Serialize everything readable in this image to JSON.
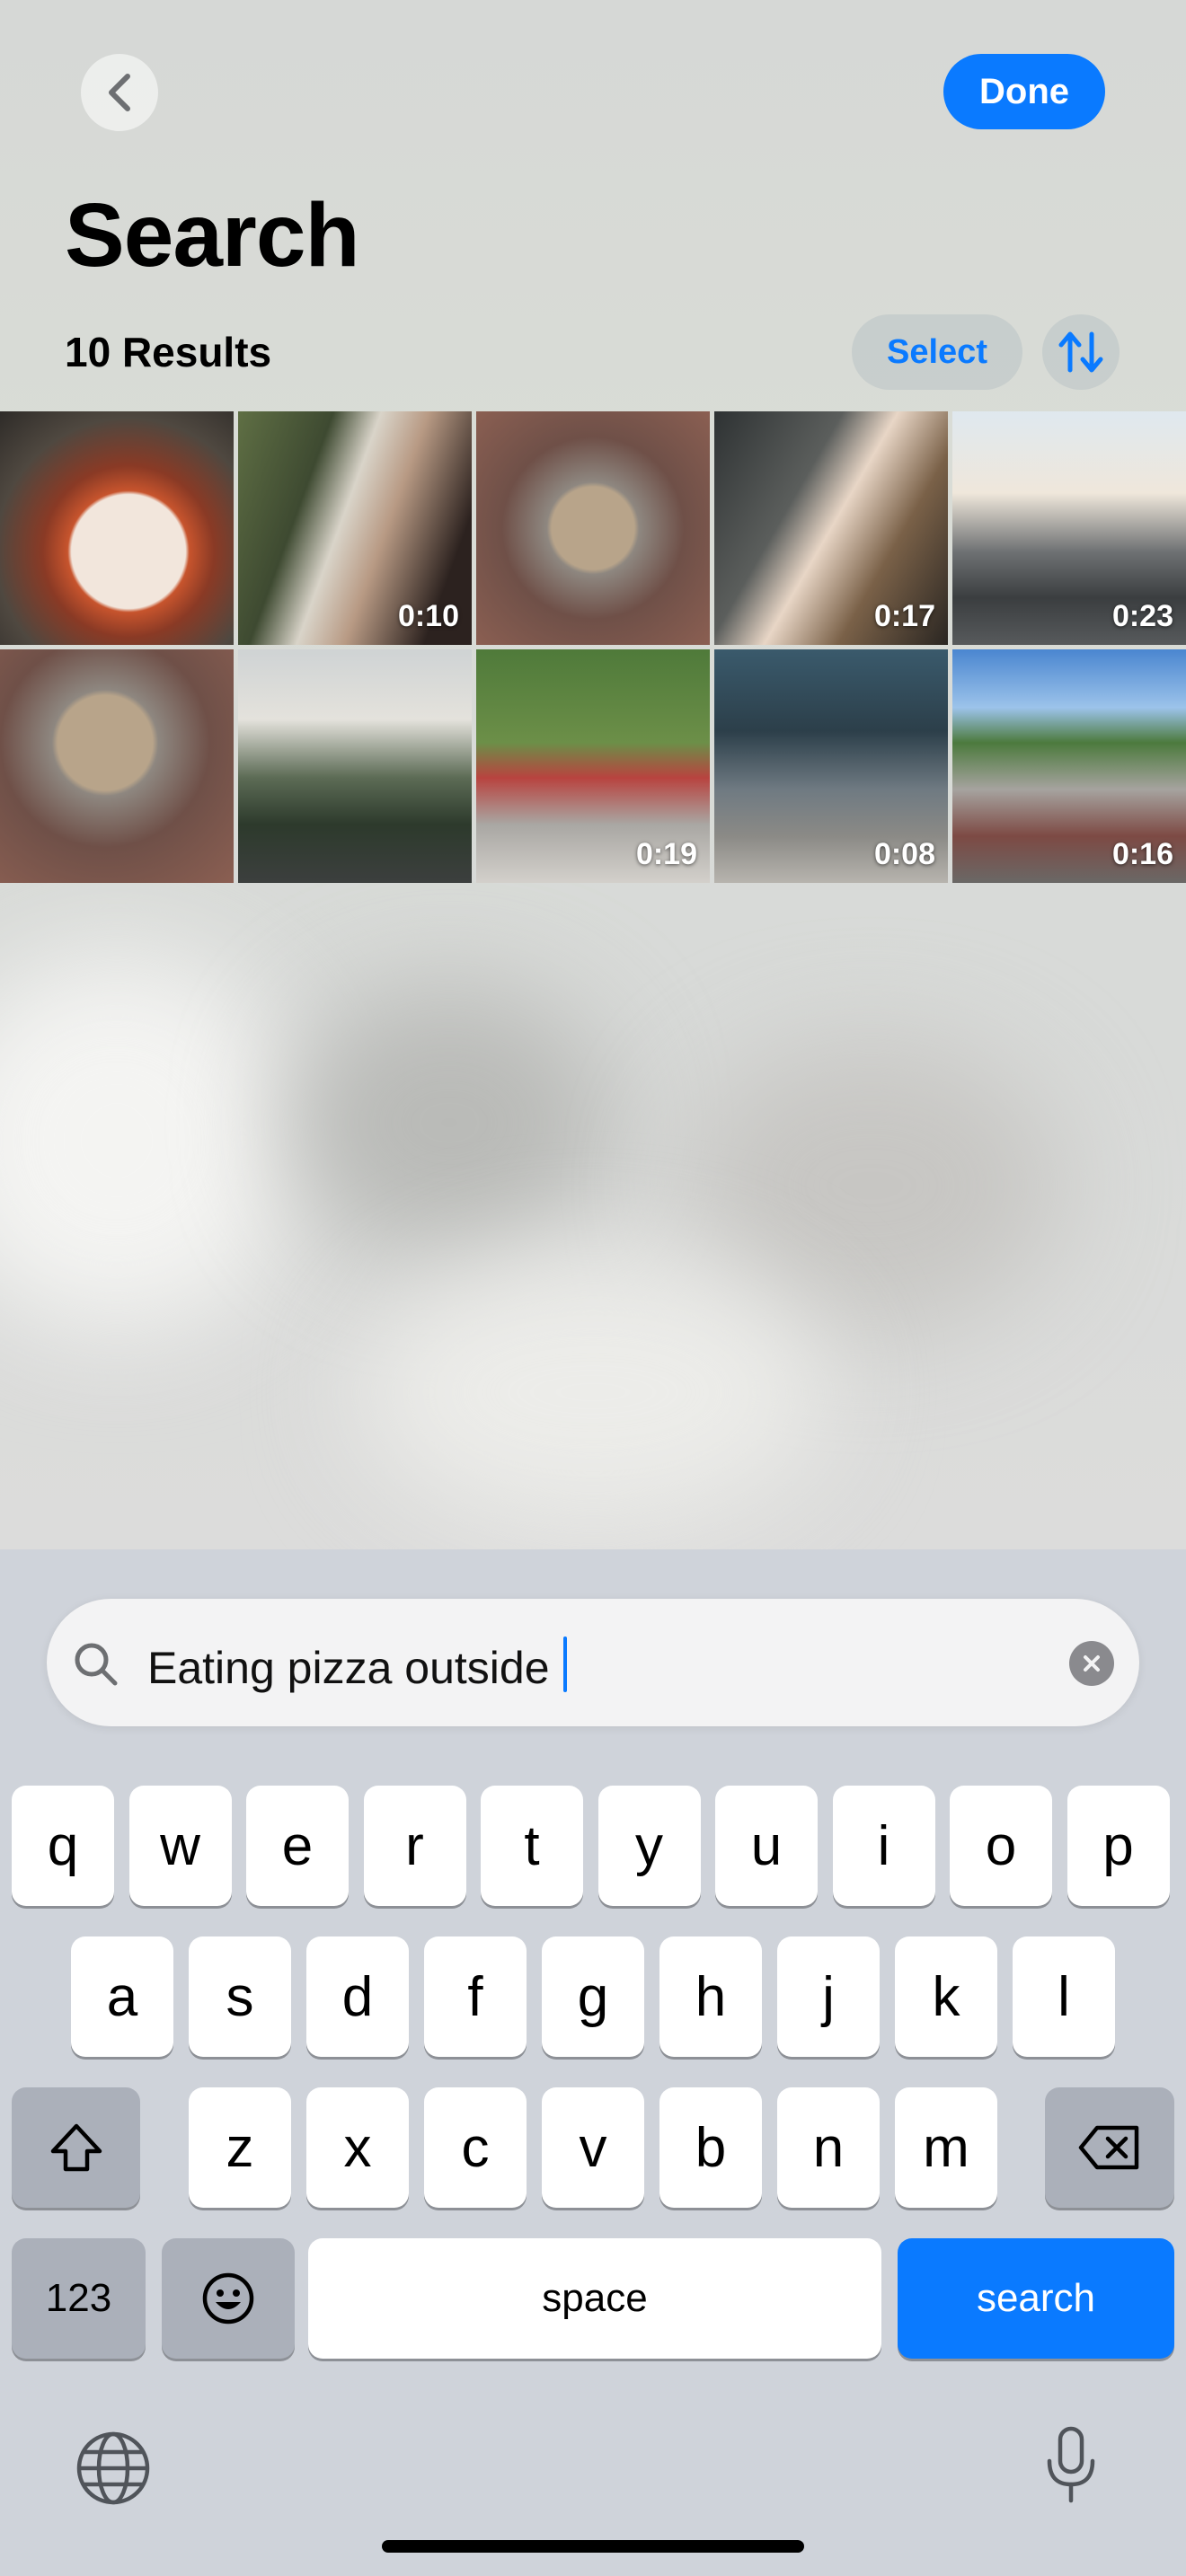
{
  "header": {
    "back_icon": "chevron-left-icon",
    "done_label": "Done",
    "title": "Search",
    "results_label": "10 Results",
    "select_label": "Select",
    "sort_icon": "sort-arrows-icon",
    "accent": "#0a7aff"
  },
  "results": [
    {
      "subject": "pulled pork sandwich",
      "duration": ""
    },
    {
      "subject": "woman eating sandwich",
      "duration": "0:10"
    },
    {
      "subject": "overhead table with pizza",
      "duration": ""
    },
    {
      "subject": "woman eating at night",
      "duration": "0:17"
    },
    {
      "subject": "street with cars",
      "duration": "0:23"
    },
    {
      "subject": "overhead table with pizza",
      "duration": ""
    },
    {
      "subject": "pizza shop building",
      "duration": ""
    },
    {
      "subject": "bicycle under tree",
      "duration": "0:19"
    },
    {
      "subject": "bikes by shop",
      "duration": "0:08"
    },
    {
      "subject": "street market",
      "duration": "0:16"
    }
  ],
  "search": {
    "icon": "magnifier-icon",
    "value": "Eating pizza outside ",
    "clear_icon": "clear-x-icon"
  },
  "keyboard": {
    "row1": [
      "q",
      "w",
      "e",
      "r",
      "t",
      "y",
      "u",
      "i",
      "o",
      "p"
    ],
    "row2": [
      "a",
      "s",
      "d",
      "f",
      "g",
      "h",
      "j",
      "k",
      "l"
    ],
    "row3": [
      "z",
      "x",
      "c",
      "v",
      "b",
      "n",
      "m"
    ],
    "shift_icon": "shift-arrow-icon",
    "delete_icon": "backspace-icon",
    "numbers_label": "123",
    "emoji_icon": "emoji-face-icon",
    "space_label": "space",
    "search_label": "search",
    "globe_icon": "globe-icon",
    "mic_icon": "microphone-icon"
  }
}
